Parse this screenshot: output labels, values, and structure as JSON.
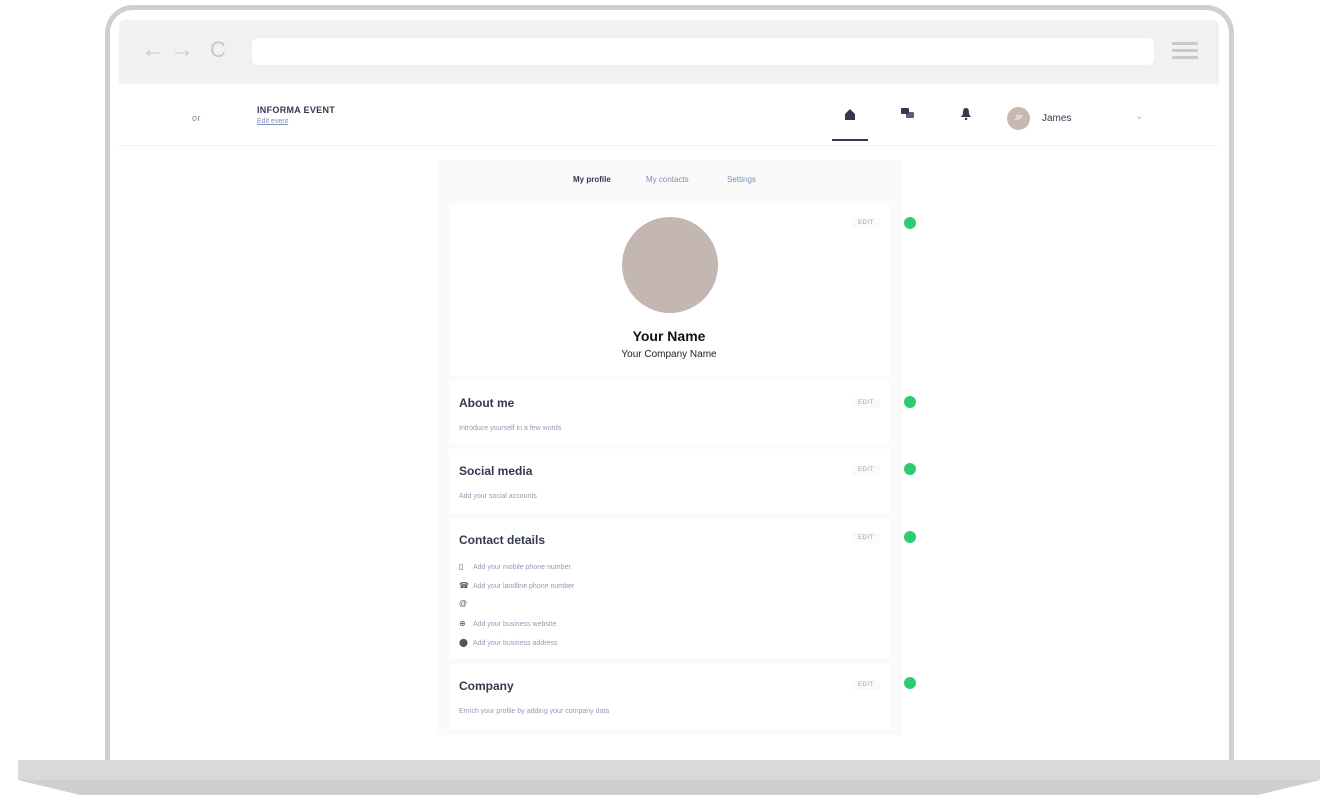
{
  "browser": {
    "back_icon": "←",
    "forward_icon": "→",
    "reload_icon": "C",
    "url": ""
  },
  "header": {
    "logo": "or",
    "event_title": "INFORMA EVENT",
    "event_link": "Edit event",
    "icons": [
      "home-icon",
      "chat-icon",
      "bell-icon"
    ],
    "user_initials": "JP",
    "user_name": "James",
    "chevron": "⌄"
  },
  "tabs": [
    {
      "label": "My profile",
      "active": true
    },
    {
      "label": "My contacts",
      "active": false
    },
    {
      "label": "Settings",
      "active": false
    }
  ],
  "profile": {
    "name": "Your Name",
    "company": "Your Company Name",
    "edit_label": "EDIT"
  },
  "sections": {
    "about": {
      "title": "About me",
      "subtitle": "Introduce yourself in a few words"
    },
    "social": {
      "title": "Social media",
      "subtitle": "Add your social accounts"
    },
    "contact": {
      "title": "Contact details",
      "rows": [
        {
          "icon": "mobile-icon",
          "text": "Add your mobile phone number"
        },
        {
          "icon": "landline-icon",
          "text": "Add your landline phone number"
        },
        {
          "icon": "email-icon",
          "text": ""
        },
        {
          "icon": "website-icon",
          "text": "Add your business website"
        },
        {
          "icon": "location-icon",
          "text": "Add your business address"
        }
      ]
    },
    "company": {
      "title": "Company",
      "subtitle": "Enrich your profile by adding your company data"
    }
  },
  "colors": {
    "accent_dark": "#333a4d",
    "link": "#7a8fb8",
    "status_dot": "#2ecc71",
    "avatar_placeholder": "#c4b6b1"
  }
}
